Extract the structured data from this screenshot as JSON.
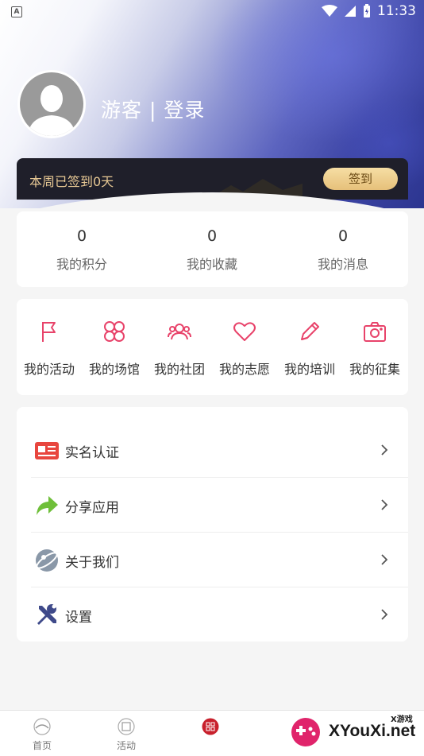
{
  "status_bar": {
    "time": "11:33",
    "app_badge": "A"
  },
  "profile": {
    "username": "游客 | 登录"
  },
  "sign_in": {
    "status_text": "本周已签到0天",
    "button_label": "签到"
  },
  "stats": [
    {
      "value": "0",
      "label": "我的积分"
    },
    {
      "value": "0",
      "label": "我的收藏"
    },
    {
      "value": "0",
      "label": "我的消息"
    }
  ],
  "shortcuts": [
    {
      "label": "我的活动",
      "icon": "flag-icon"
    },
    {
      "label": "我的场馆",
      "icon": "venue-icon"
    },
    {
      "label": "我的社团",
      "icon": "group-icon"
    },
    {
      "label": "我的志愿",
      "icon": "heart-icon"
    },
    {
      "label": "我的培训",
      "icon": "pencil-icon"
    },
    {
      "label": "我的征集",
      "icon": "camera-icon"
    }
  ],
  "menu": [
    {
      "label": "实名认证",
      "icon": "id-card-icon"
    },
    {
      "label": "分享应用",
      "icon": "share-arrow-icon"
    },
    {
      "label": "关于我们",
      "icon": "about-icon"
    },
    {
      "label": "设置",
      "icon": "tools-icon"
    }
  ],
  "tabs": [
    {
      "label": "首页",
      "icon": "home-icon"
    },
    {
      "label": "活动",
      "icon": "activity-icon"
    },
    {
      "label": "",
      "icon": "center-icon"
    },
    {
      "label": "",
      "icon": ""
    }
  ],
  "watermark": {
    "text": "XYouXi.net",
    "small": "X游戏"
  },
  "colors": {
    "accent": "#e8436a",
    "gold": "#e6c07a",
    "sign_bar": "#1f1f2a"
  }
}
